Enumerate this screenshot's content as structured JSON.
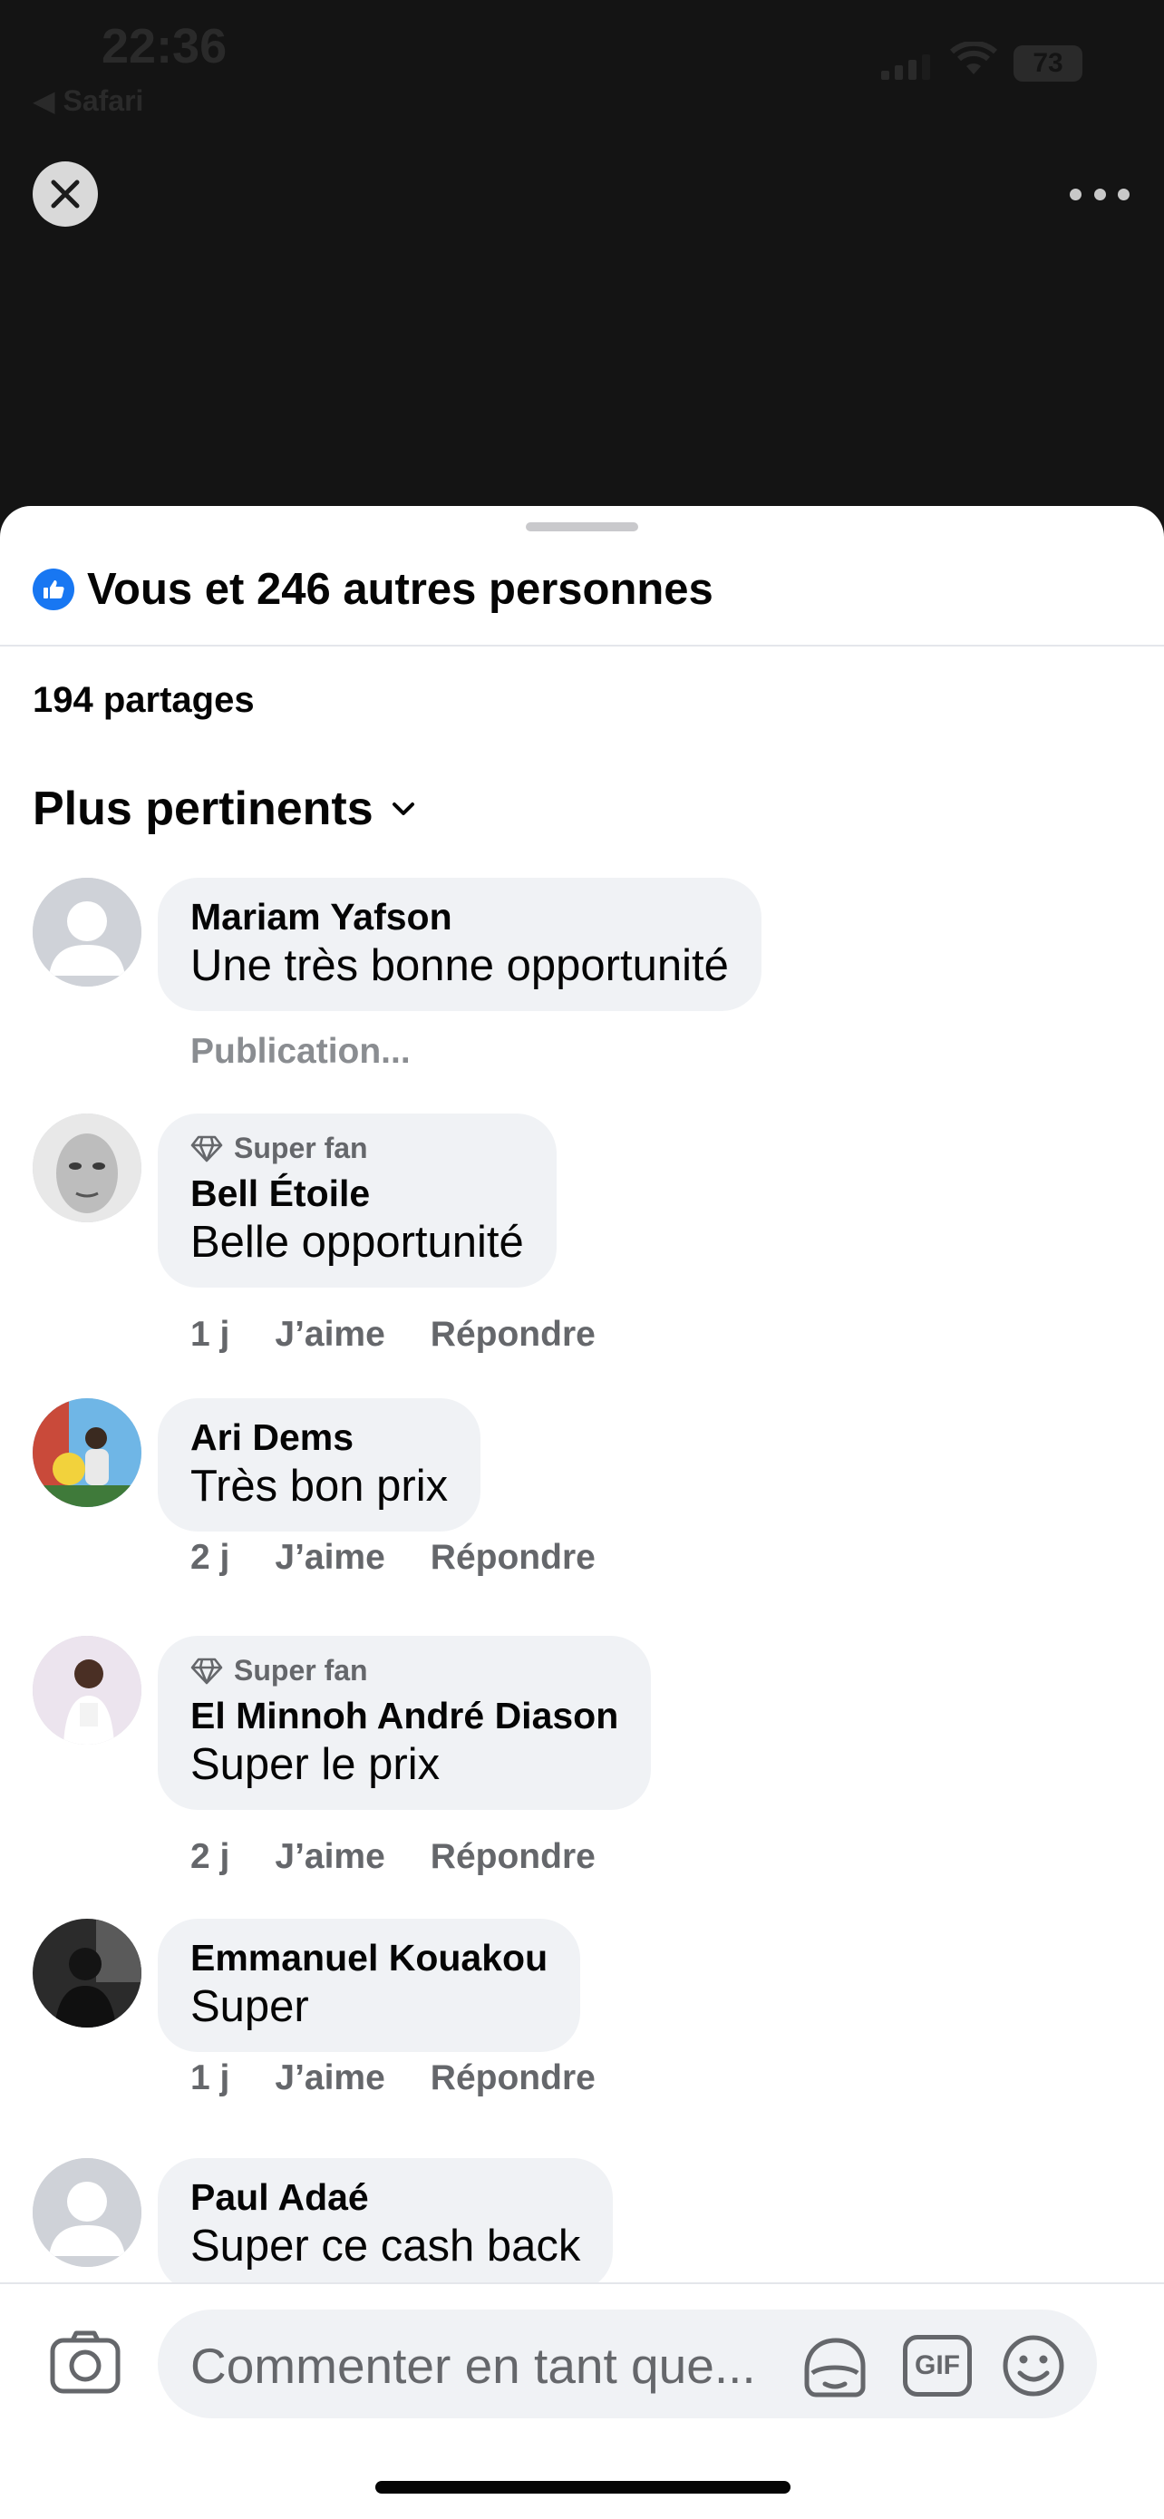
{
  "status_bar": {
    "time": "22:36",
    "back_label": "◀ Safari",
    "battery": "73"
  },
  "top_bar": {
    "close_icon": "close-icon",
    "more_icon": "more-icon"
  },
  "sheet": {
    "reactions_text": "Vous et 246 autres personnes",
    "shares_text": "194 partages",
    "sort_label": "Plus pertinents"
  },
  "comments": [
    {
      "name": "Mariam Yafson",
      "text": "Une très bonne opportunité",
      "badge": "",
      "pending": "Publication...",
      "time": "",
      "like": "",
      "reply": ""
    },
    {
      "name": "Bell Étoile",
      "text": "Belle opportunité",
      "badge": "Super fan",
      "time": "1 j",
      "like": "J’aime",
      "reply": "Répondre"
    },
    {
      "name": "Ari Dems",
      "text": "Très bon prix",
      "badge": "",
      "time": "2 j",
      "like": "J’aime",
      "reply": "Répondre"
    },
    {
      "name": "El Minnoh André Diason",
      "text": "Super le prix",
      "badge": "Super fan",
      "time": "2 j",
      "like": "J’aime",
      "reply": "Répondre"
    },
    {
      "name": "Emmanuel Kouakou",
      "text": "Super",
      "badge": "",
      "time": "1 j",
      "like": "J’aime",
      "reply": "Répondre"
    },
    {
      "name": "Paul Adaé",
      "text": "Super ce cash back",
      "badge": "",
      "time": "",
      "like": "",
      "reply": ""
    }
  ],
  "composer": {
    "placeholder": "Commenter en tant que...",
    "gif_label": "GIF"
  },
  "colors": {
    "accent": "#1877f2",
    "bubble": "#f0f2f5",
    "secondary_text": "#65676b"
  }
}
